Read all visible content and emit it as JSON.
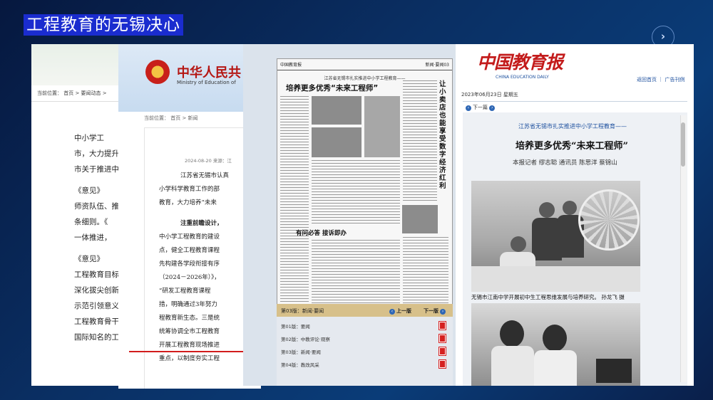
{
  "slide": {
    "title": "工程教育的无锡决心",
    "next_icon": "chevron-right-icon",
    "next_glyph": "›"
  },
  "panel1": {
    "breadcrumb": "当前位置： 首页 > 要闻动态 >",
    "lines": [
      "中小学工",
      "市，大力提升",
      "市关于推进中",
      "《意见》",
      "师资队伍、推",
      "条细则。《",
      "一体推进，",
      "《意见》",
      "工程教育目标",
      "深化拔尖创新",
      "示范引领意义",
      "工程教育骨干",
      "国际知名的工"
    ]
  },
  "panel2": {
    "ministry_title": "中华人民共",
    "ministry_sub": "Ministry of Education of",
    "breadcrumb": "当前位置： 首页 > 新闻",
    "meta": "2024-08-20  来源：江",
    "lines": [
      "江苏省无锡市认真",
      "小学科学教育工作的部",
      "教育，大力培养“未来",
      "注重前瞻设计，",
      "中小学工程教育的建设",
      "点，健全工程教育课程",
      "先构建各学段衔接有序",
      "（2024－2026年）》，",
      "“研发工程教育课程",
      "措，明确通过3年努力",
      "程教育新生态。三是统",
      "统筹协调全市工程教育",
      "开展工程教育现场推进",
      "重点，以制度夯实工程"
    ]
  },
  "newspaper": {
    "masthead": "中国教育报",
    "page_tag": "新闻·要闻03",
    "kicker": "江苏省无锡市扎实推进中小学工程教育——",
    "headline": "培养更多优秀“未来工程师”",
    "side_headline": "让小卖店也能享受数字经济红利",
    "sub_headline": "有问必答 接诉即办",
    "bar_page": "第03版：新闻·要闻",
    "prev": "上一版",
    "next": "下一版",
    "pages": [
      "第01版：要闻",
      "第02版：中教评论·观察",
      "第03版：新闻·要闻",
      "第04版：教改风采"
    ]
  },
  "article": {
    "logo": "中国教育报",
    "logo_sub": "CHINA EDUCATION DAILY",
    "top_links": "返回首页 ｜ 广告刊例",
    "date": "2023年06月23日 星期五",
    "toolbar_next": "下一篇",
    "kicker": "江苏省无锡市扎实推进中小学工程教育——",
    "headline": "培养更多优秀“未来工程师”",
    "byline": "本报记者  缪志聪  通讯员  陈思洋  蔡锦山",
    "caption": "无锡市江南中学开展初中生工程思维发展与培养研究。  孙龙飞  摄"
  }
}
